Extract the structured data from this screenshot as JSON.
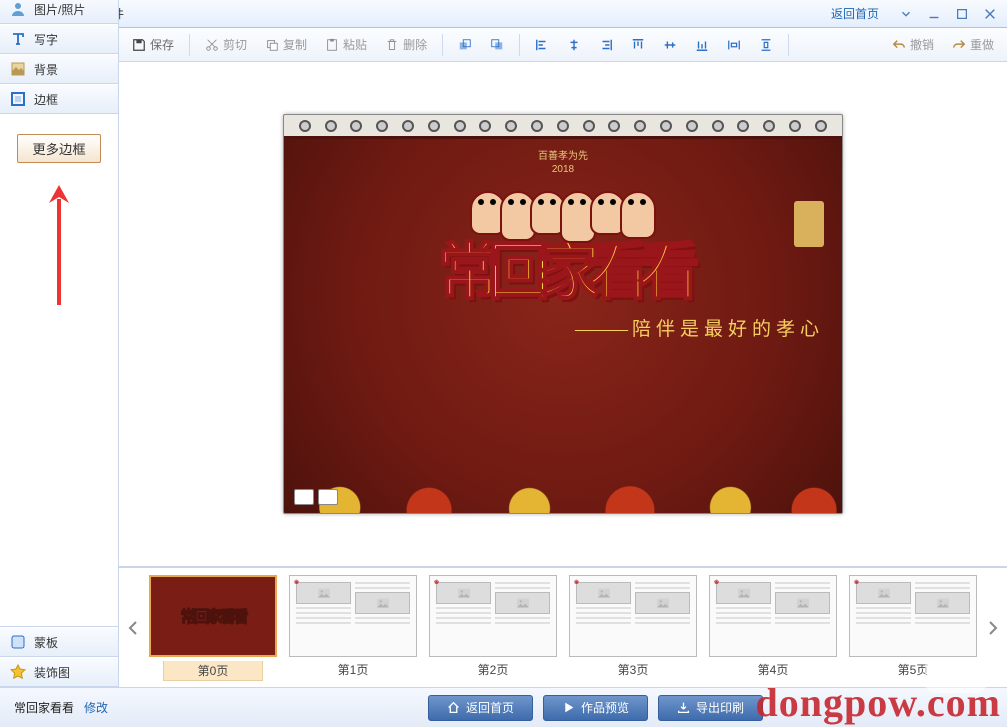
{
  "title": "晨光相册制作软件",
  "home_link": "返回首页",
  "toolbar": {
    "save": "保存",
    "cut": "剪切",
    "copy": "复制",
    "paste": "粘贴",
    "delete": "删除",
    "undo": "撤销",
    "redo": "重做"
  },
  "sidebar": {
    "items": [
      {
        "label": "图片/照片"
      },
      {
        "label": "写字"
      },
      {
        "label": "背景"
      },
      {
        "label": "边框"
      }
    ],
    "more_frames": "更多边框",
    "bottom": [
      {
        "label": "蒙板"
      },
      {
        "label": "装饰图"
      }
    ]
  },
  "canvas": {
    "top_text": "百善孝为先",
    "year": "2018",
    "headline": "常回家看看",
    "subline_dash": "———",
    "subline": "陪伴是最好的孝心"
  },
  "pages": [
    {
      "label": "第0页",
      "cover": true
    },
    {
      "label": "第1页"
    },
    {
      "label": "第2页"
    },
    {
      "label": "第3页"
    },
    {
      "label": "第4页"
    },
    {
      "label": "第5页"
    }
  ],
  "footer": {
    "project": "常回家看看",
    "edit": "修改",
    "back": "返回首页",
    "preview": "作品预览",
    "export": "导出印刷"
  },
  "watermark": "dongpow.com"
}
